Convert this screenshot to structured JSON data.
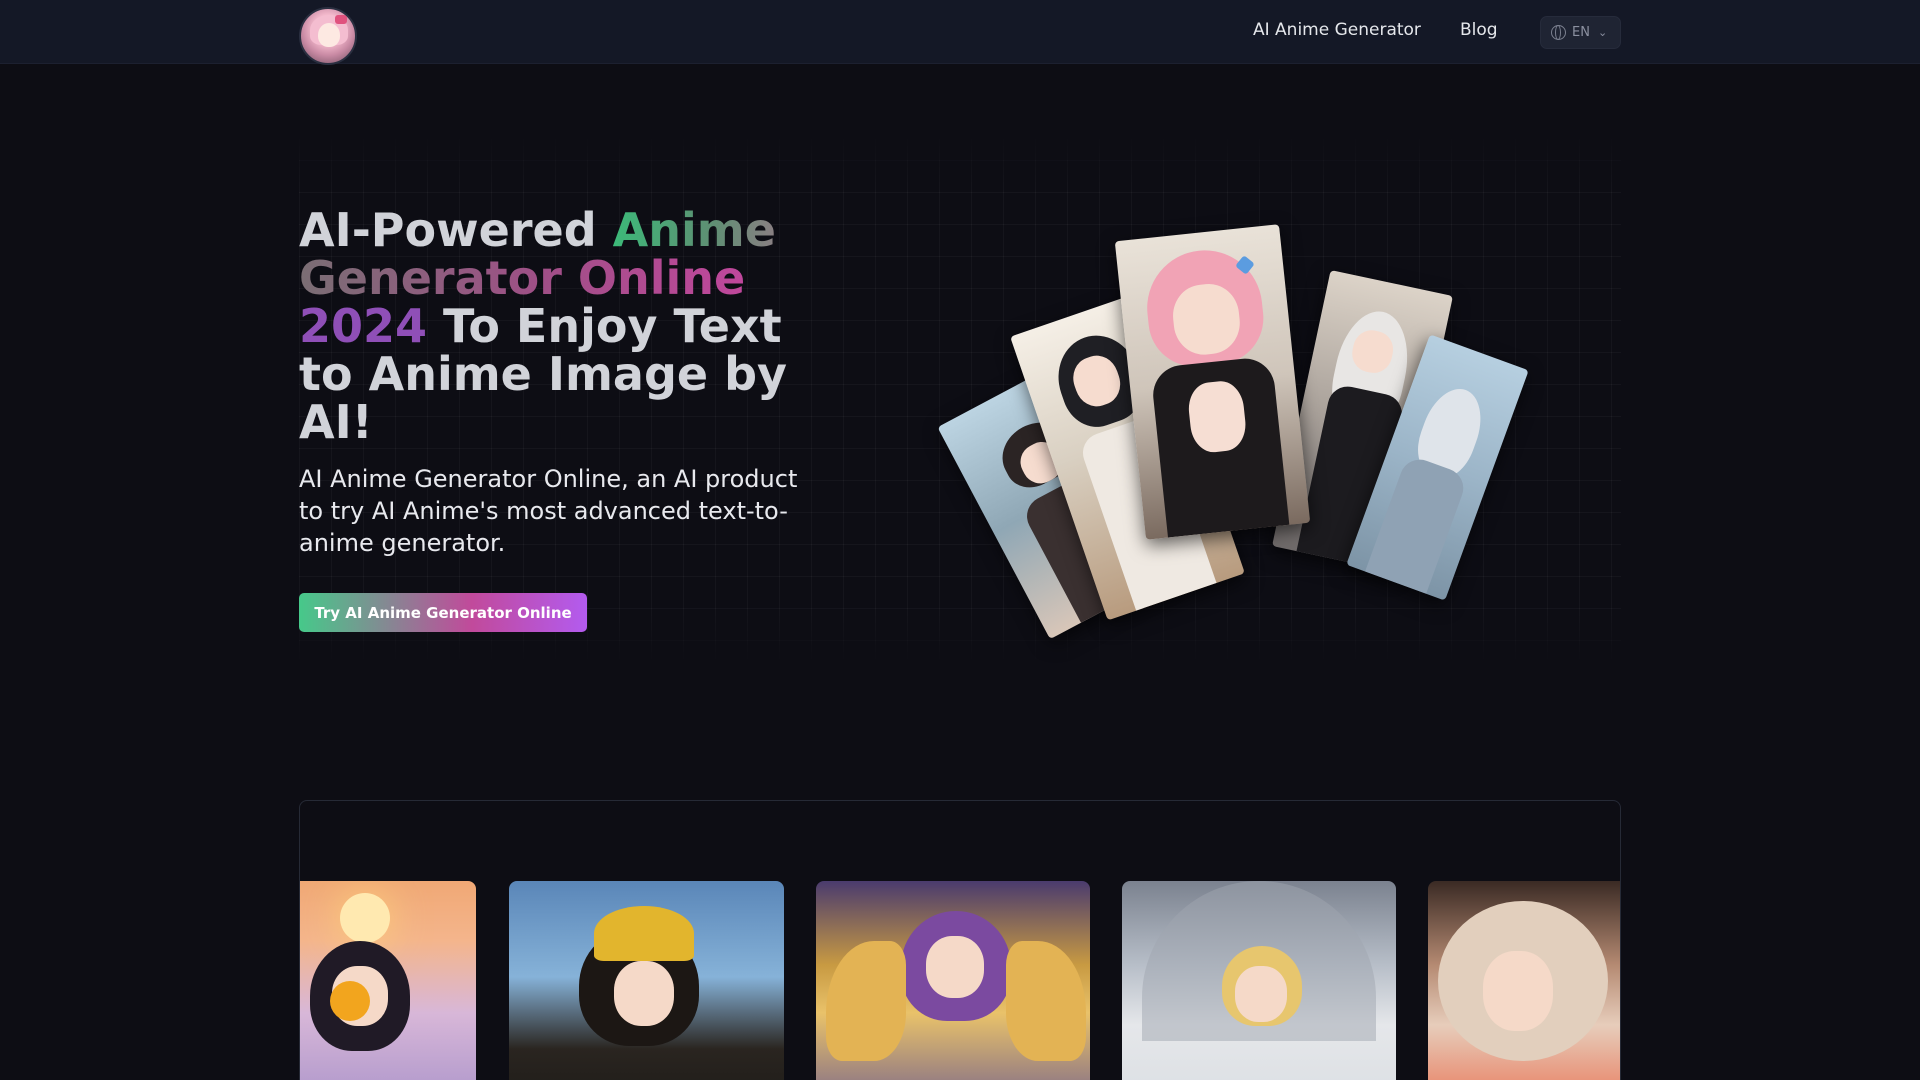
{
  "header": {
    "logo_alt": "AI Anime Generator logo",
    "nav": [
      {
        "label": "AI Anime Generator"
      },
      {
        "label": "Blog"
      }
    ],
    "language": {
      "selected": "EN",
      "icon": "globe-icon",
      "chevron": "chevron-down-icon"
    }
  },
  "hero": {
    "title_part1": "AI-Powered ",
    "title_highlight1": "Anime",
    "title_highlight2": "Generator Online",
    "title_highlight3": "2024",
    "title_part2": " To Enjoy Text to Anime Image by AI!",
    "subtitle": "AI Anime Generator Online, an AI product to try AI Anime's most advanced text-to-anime generator.",
    "cta_label": "Try AI Anime Generator Online"
  },
  "colors": {
    "background": "#0d0d14",
    "header_bg": "#141826",
    "cta_gradient": [
      "#46c98a",
      "#c14a9b",
      "#b35bef"
    ]
  },
  "showcase": {
    "fan_cards": 5,
    "gallery_images": 5
  }
}
